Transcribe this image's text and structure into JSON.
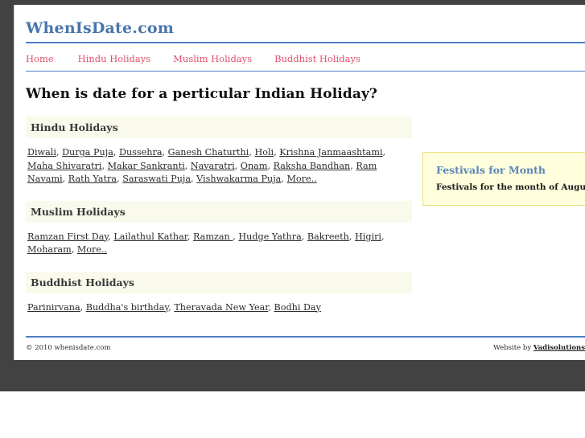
{
  "site": {
    "title": "WhenIsDate.com"
  },
  "nav": {
    "items": [
      {
        "label": "Home",
        "name": "nav-home"
      },
      {
        "label": "Hindu Holidays",
        "name": "nav-hindu-holidays"
      },
      {
        "label": "Muslim Holidays",
        "name": "nav-muslim-holidays"
      },
      {
        "label": "Buddhist Holidays",
        "name": "nav-buddhist-holidays"
      }
    ]
  },
  "main": {
    "page_title": "When is date for a perticular Indian Holiday?",
    "sections": [
      {
        "heading": "Hindu Holidays",
        "links": [
          "Diwali",
          "Durga Puja",
          "Dussehra",
          "Ganesh Chaturthi",
          "Holi",
          "Krishna Janmaashtami",
          "Maha Shivaratri",
          "Makar Sankranti",
          "Navaratri",
          "Onam",
          "Raksha Bandhan",
          "Ram Navami",
          "Rath Yatra",
          "Saraswati Puja",
          "Vishwakarma Puja",
          "More.."
        ]
      },
      {
        "heading": "Muslim Holidays",
        "links": [
          "Ramzan First Day",
          "Lailathul Kathar",
          "Ramzan ",
          "Hudge Yathra",
          "Bakreeth",
          "Higiri",
          "Moharam",
          "More.."
        ]
      },
      {
        "heading": "Buddhist Holidays",
        "links": [
          "Parinirvana",
          "Buddha's birthday",
          "Theravada New Year",
          "Bodhi Day"
        ]
      }
    ]
  },
  "sidebar": {
    "heading": "Festivals for Month",
    "text": "Festivals for the month of August"
  },
  "footer": {
    "copyright": "© 2010 whenisdate.com",
    "credit_prefix": "Website by ",
    "credit_link": "Vadisolutions"
  },
  "colors": {
    "chrome": "#424242",
    "brand_blue": "#4876aa",
    "rule_blue": "#4d7fc4",
    "nav_red": "#e0506a",
    "section_band": "#fafaec",
    "sidebar_bg": "#ffffdd",
    "sidebar_border": "#eadf7a"
  }
}
